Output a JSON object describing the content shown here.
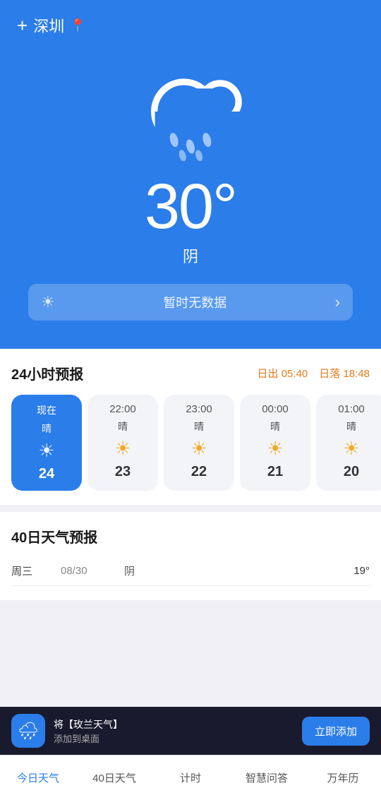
{
  "header": {
    "city": "深圳",
    "add_label": "+",
    "location_icon": "📍"
  },
  "hero": {
    "temperature": "30°",
    "description": "阴",
    "aqi_placeholder": "暂时无数据",
    "aqi_icon": "☀"
  },
  "hourly": {
    "section_title": "24小时预报",
    "sunrise_label": "日出",
    "sunrise_time": "05:40",
    "sunset_label": "日落",
    "sunset_time": "18:48",
    "cards": [
      {
        "time": "现在",
        "weather": "晴",
        "temp": "24",
        "active": true
      },
      {
        "time": "22:00",
        "weather": "晴",
        "temp": "23",
        "active": false
      },
      {
        "time": "23:00",
        "weather": "晴",
        "temp": "22",
        "active": false
      },
      {
        "time": "00:00",
        "weather": "晴",
        "temp": "21",
        "active": false
      },
      {
        "time": "01:00",
        "weather": "晴",
        "temp": "20",
        "active": false
      }
    ]
  },
  "forecast": {
    "section_title": "40日天气预报",
    "rows": [
      {
        "day": "周三",
        "date": "08/30",
        "desc": "阴",
        "temp": "19°"
      }
    ]
  },
  "toast": {
    "icon": "🌧",
    "line1": "将【玫兰天气】",
    "line2": "添加到桌面",
    "button_label": "立即添加"
  },
  "nav": {
    "items": [
      {
        "label": "今日天气",
        "active": true
      },
      {
        "label": "40日天气",
        "active": false
      },
      {
        "label": "计时",
        "active": false
      },
      {
        "label": "智慧问答",
        "active": false
      },
      {
        "label": "万年历",
        "active": false
      }
    ]
  },
  "colors": {
    "primary": "#2b7de9",
    "background_hero": "#2b7de9"
  }
}
